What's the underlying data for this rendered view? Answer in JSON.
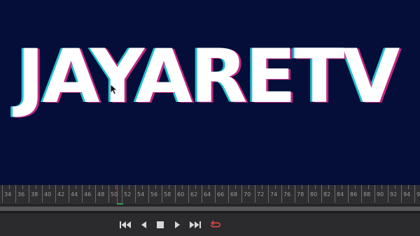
{
  "viewer": {
    "title_text": "JAYARETV"
  },
  "timeline": {
    "ticks": [
      "34",
      "36",
      "38",
      "40",
      "42",
      "44",
      "46",
      "48",
      "50",
      "52",
      "54",
      "56",
      "58",
      "60",
      "62",
      "64",
      "66",
      "68",
      "70",
      "72",
      "74",
      "76",
      "78",
      "80",
      "82",
      "84",
      "86",
      "88",
      "90",
      "92",
      "94",
      "96"
    ],
    "current_frame": "52"
  },
  "transport": {
    "buttons": [
      "skip-to-start",
      "step-back",
      "stop",
      "play",
      "skip-to-end",
      "loop"
    ]
  },
  "colors": {
    "background": "#040e38",
    "title": "#ffffff",
    "glitch_cyan": "#28e0ee",
    "glitch_magenta": "#e52b8e",
    "playhead": "#d6342c",
    "loop_active": "#e0473d"
  }
}
